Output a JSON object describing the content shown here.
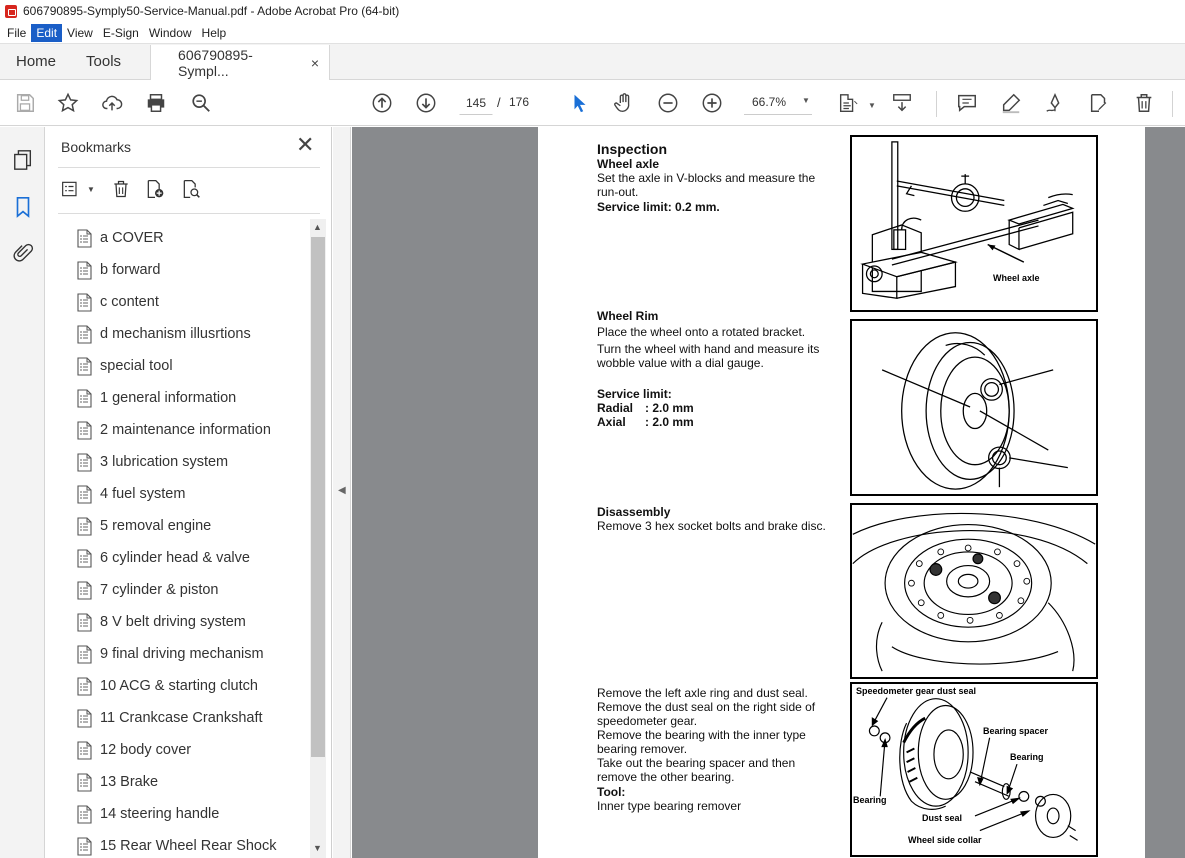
{
  "window": {
    "title": "606790895-Symply50-Service-Manual.pdf - Adobe Acrobat Pro (64-bit)"
  },
  "menu": [
    "File",
    "Edit",
    "View",
    "E-Sign",
    "Window",
    "Help"
  ],
  "tabs": {
    "home": "Home",
    "tools": "Tools",
    "doc": "606790895-Sympl...",
    "close": "×"
  },
  "toolbar": {
    "page_current": "145",
    "page_sep": "/",
    "page_total": "176",
    "zoom": "66.7%"
  },
  "bookmarks": {
    "title": "Bookmarks",
    "close": "✕",
    "items": [
      "a COVER",
      "b  forward",
      "c content",
      "d mechanism illusrtions",
      "special tool",
      "1 general information",
      "2 maintenance information",
      "3  lubrication system",
      "4  fuel system",
      "5  removal engine",
      "6  cylinder head & valve",
      "7  cylinder & piston",
      "8  V belt driving system",
      "9 final driving mechanism",
      "10  ACG & starting clutch",
      "11 Crankcase Crankshaft",
      "12  body cover",
      "13  Brake",
      "14 steering handle",
      "15 Rear Wheel Rear Shock"
    ]
  },
  "document": {
    "inspection": {
      "heading": "Inspection",
      "sub": "Wheel axle",
      "line1": "Set the axle in V-blocks and measure the",
      "line2": "run-out.",
      "limit": "Service limit: 0.2 mm.",
      "fig_label": "Wheel axle"
    },
    "rim": {
      "heading": "Wheel Rim",
      "line1": "Place the wheel onto a rotated bracket.",
      "line2": "Turn the wheel with hand and measure its",
      "line3": "wobble value with a dial gauge.",
      "limit_label": "Service limit:",
      "radial_label": "Radial",
      "radial_value": ": 2.0 mm",
      "axial_label": "Axial",
      "axial_value": ": 2.0 mm"
    },
    "disassembly": {
      "heading": "Disassembly",
      "line1": "Remove 3 hex socket bolts and brake disc."
    },
    "removal": {
      "line1": "Remove the left axle ring and dust seal.",
      "line2": "Remove the dust seal on the right side of",
      "line3": "speedometer gear.",
      "line4": "Remove the bearing with the inner type",
      "line5": "bearing remover.",
      "line6": "Take out the bearing spacer and then",
      "line7": "remove the other bearing.",
      "tool_label": "Tool:",
      "tool_value": "Inner type bearing remover",
      "fig_labels": {
        "speedo": "Speedometer gear dust seal",
        "spacer": "Bearing spacer",
        "bearing_r": "Bearing",
        "bearing_l": "Bearing",
        "dust_seal": "Dust seal",
        "collar": "Wheel side collar"
      }
    }
  }
}
